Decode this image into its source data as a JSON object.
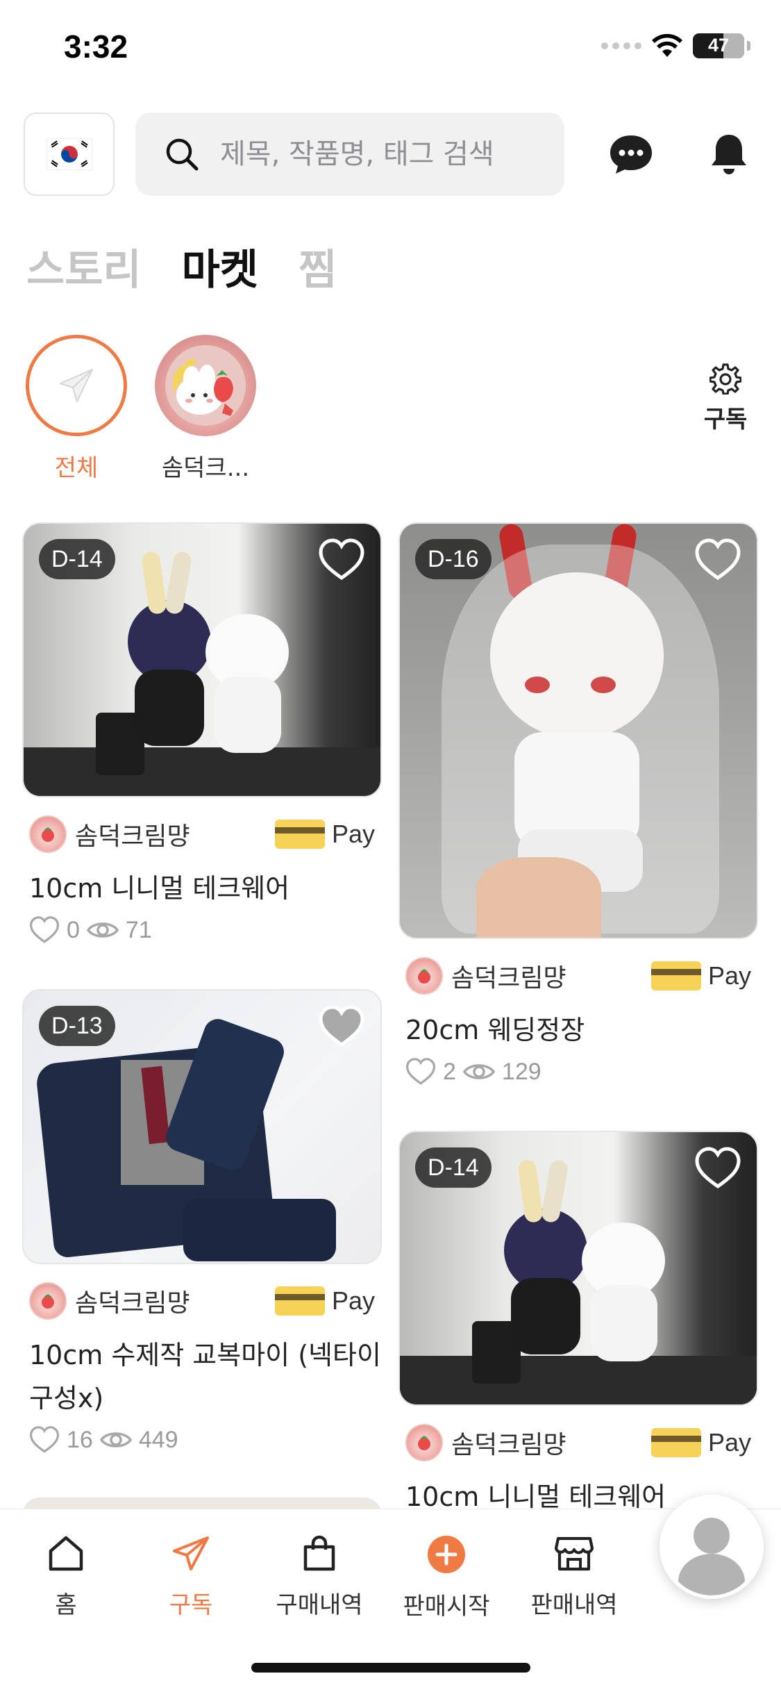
{
  "status": {
    "time": "3:32",
    "battery": "47"
  },
  "header": {
    "search_placeholder": "제목, 작품명, 태그 검색"
  },
  "tabs": [
    {
      "label": "스토리",
      "active": false
    },
    {
      "label": "마켓",
      "active": true
    },
    {
      "label": "찜",
      "active": false
    }
  ],
  "subscriptions": {
    "items": [
      {
        "label": "전체",
        "active": true
      },
      {
        "label": "솜덕크..."
      }
    ],
    "settings_label": "구독"
  },
  "products": [
    {
      "d_day": "D-14",
      "seller": "솜덕크림먕",
      "pay": "Pay",
      "title": "10cm 니니멀 테크웨어",
      "likes": "0",
      "views": "71",
      "liked": false
    },
    {
      "d_day": "D-16",
      "seller": "솜덕크림먕",
      "pay": "Pay",
      "title": "20cm 웨딩정장",
      "likes": "2",
      "views": "129",
      "liked": false
    },
    {
      "d_day": "D-13",
      "seller": "솜덕크림먕",
      "pay": "Pay",
      "title": "10cm 수제작 교복마이 (넥타이 구성x)",
      "likes": "16",
      "views": "449",
      "liked": true
    },
    {
      "d_day": "D-14",
      "seller": "솜덕크림먕",
      "pay": "Pay",
      "title": "10cm 니니멀 테크웨어"
    }
  ],
  "bottom_nav": [
    {
      "label": "홈",
      "icon": "home-icon"
    },
    {
      "label": "구독",
      "icon": "paper-plane-icon",
      "active": true
    },
    {
      "label": "구매내역",
      "icon": "shopping-bag-icon"
    },
    {
      "label": "판매시작",
      "icon": "plus-circle-icon"
    },
    {
      "label": "판매내역",
      "icon": "store-icon"
    }
  ],
  "colors": {
    "accent": "#ef7a43",
    "inactive_tab": "#c5c5c5",
    "pay_card": "#f6d257"
  }
}
